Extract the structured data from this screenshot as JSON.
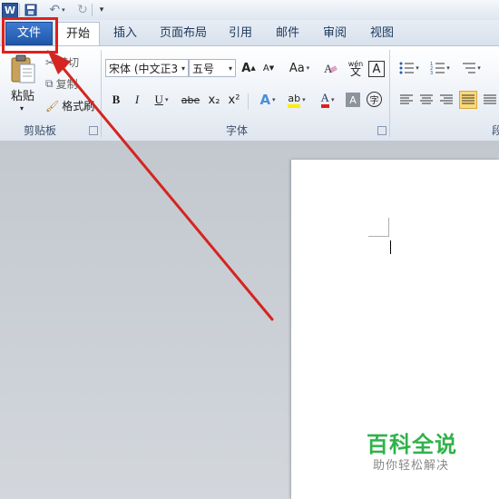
{
  "qat": {
    "app_icon": "W",
    "save_icon": "save-icon",
    "undo_icon": "↶",
    "redo_icon": "↻",
    "customize_icon": "▾"
  },
  "tabs": [
    {
      "label": "文件"
    },
    {
      "label": "开始"
    },
    {
      "label": "插入"
    },
    {
      "label": "页面布局"
    },
    {
      "label": "引用"
    },
    {
      "label": "邮件"
    },
    {
      "label": "审阅"
    },
    {
      "label": "视图"
    }
  ],
  "clipboard": {
    "paste_label": "粘贴",
    "cut_label": "剪切",
    "copy_label": "复制",
    "format_painter_label": "格式刷",
    "group_label": "剪贴板"
  },
  "font": {
    "font_name": "宋体 (中文正3",
    "font_size": "五号",
    "grow_label": "A",
    "shrink_label": "A",
    "change_case_label": "Aa",
    "clear_format_label": "A",
    "bold": "B",
    "italic": "I",
    "underline": "U",
    "strikethrough": "abe",
    "subscript": "x₂",
    "superscript": "x²",
    "text_effects": "A",
    "highlight": "ab",
    "font_color": "A",
    "char_shading": "A",
    "enclose": "字",
    "phonetic": "wén",
    "group_label": "字体"
  },
  "paragraph": {
    "group_label": "段"
  },
  "watermark": {
    "title": "百科全说",
    "subtitle": "助你轻松解决"
  },
  "colors": {
    "highlight_box": "#e0201b",
    "arrow": "#d42521",
    "file_tab": "#2b64bd",
    "watermark": "#2fb34a"
  }
}
